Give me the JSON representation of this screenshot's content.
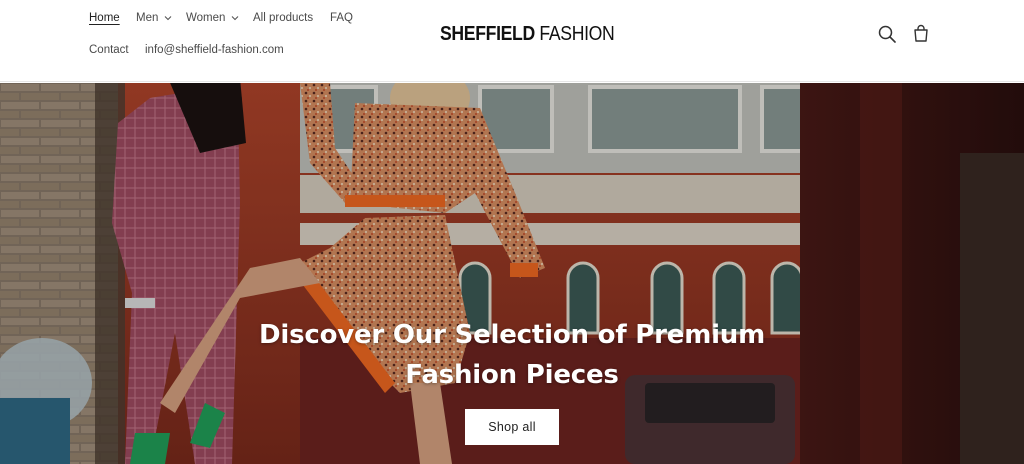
{
  "header": {
    "nav": [
      {
        "label": "Home",
        "active": true,
        "dropdown": false
      },
      {
        "label": "Men",
        "active": false,
        "dropdown": true
      },
      {
        "label": "Women",
        "active": false,
        "dropdown": true
      },
      {
        "label": "All products",
        "active": false,
        "dropdown": false
      },
      {
        "label": "FAQ",
        "active": false,
        "dropdown": false
      },
      {
        "label": "Contact",
        "active": false,
        "dropdown": false
      },
      {
        "label": "info@sheffield-fashion.com",
        "active": false,
        "dropdown": false
      }
    ],
    "logo_part1": "SHEFFIELD",
    "logo_part2": "FASHION",
    "icons": {
      "search": "search-icon",
      "cart": "cart-icon"
    }
  },
  "hero": {
    "title": "Discover Our Selection of Premium Fashion Pieces",
    "button_label": "Shop all"
  },
  "colors": {
    "accent": "#ff6a1a",
    "text_dark": "#222222",
    "button_bg": "#ffffff"
  }
}
